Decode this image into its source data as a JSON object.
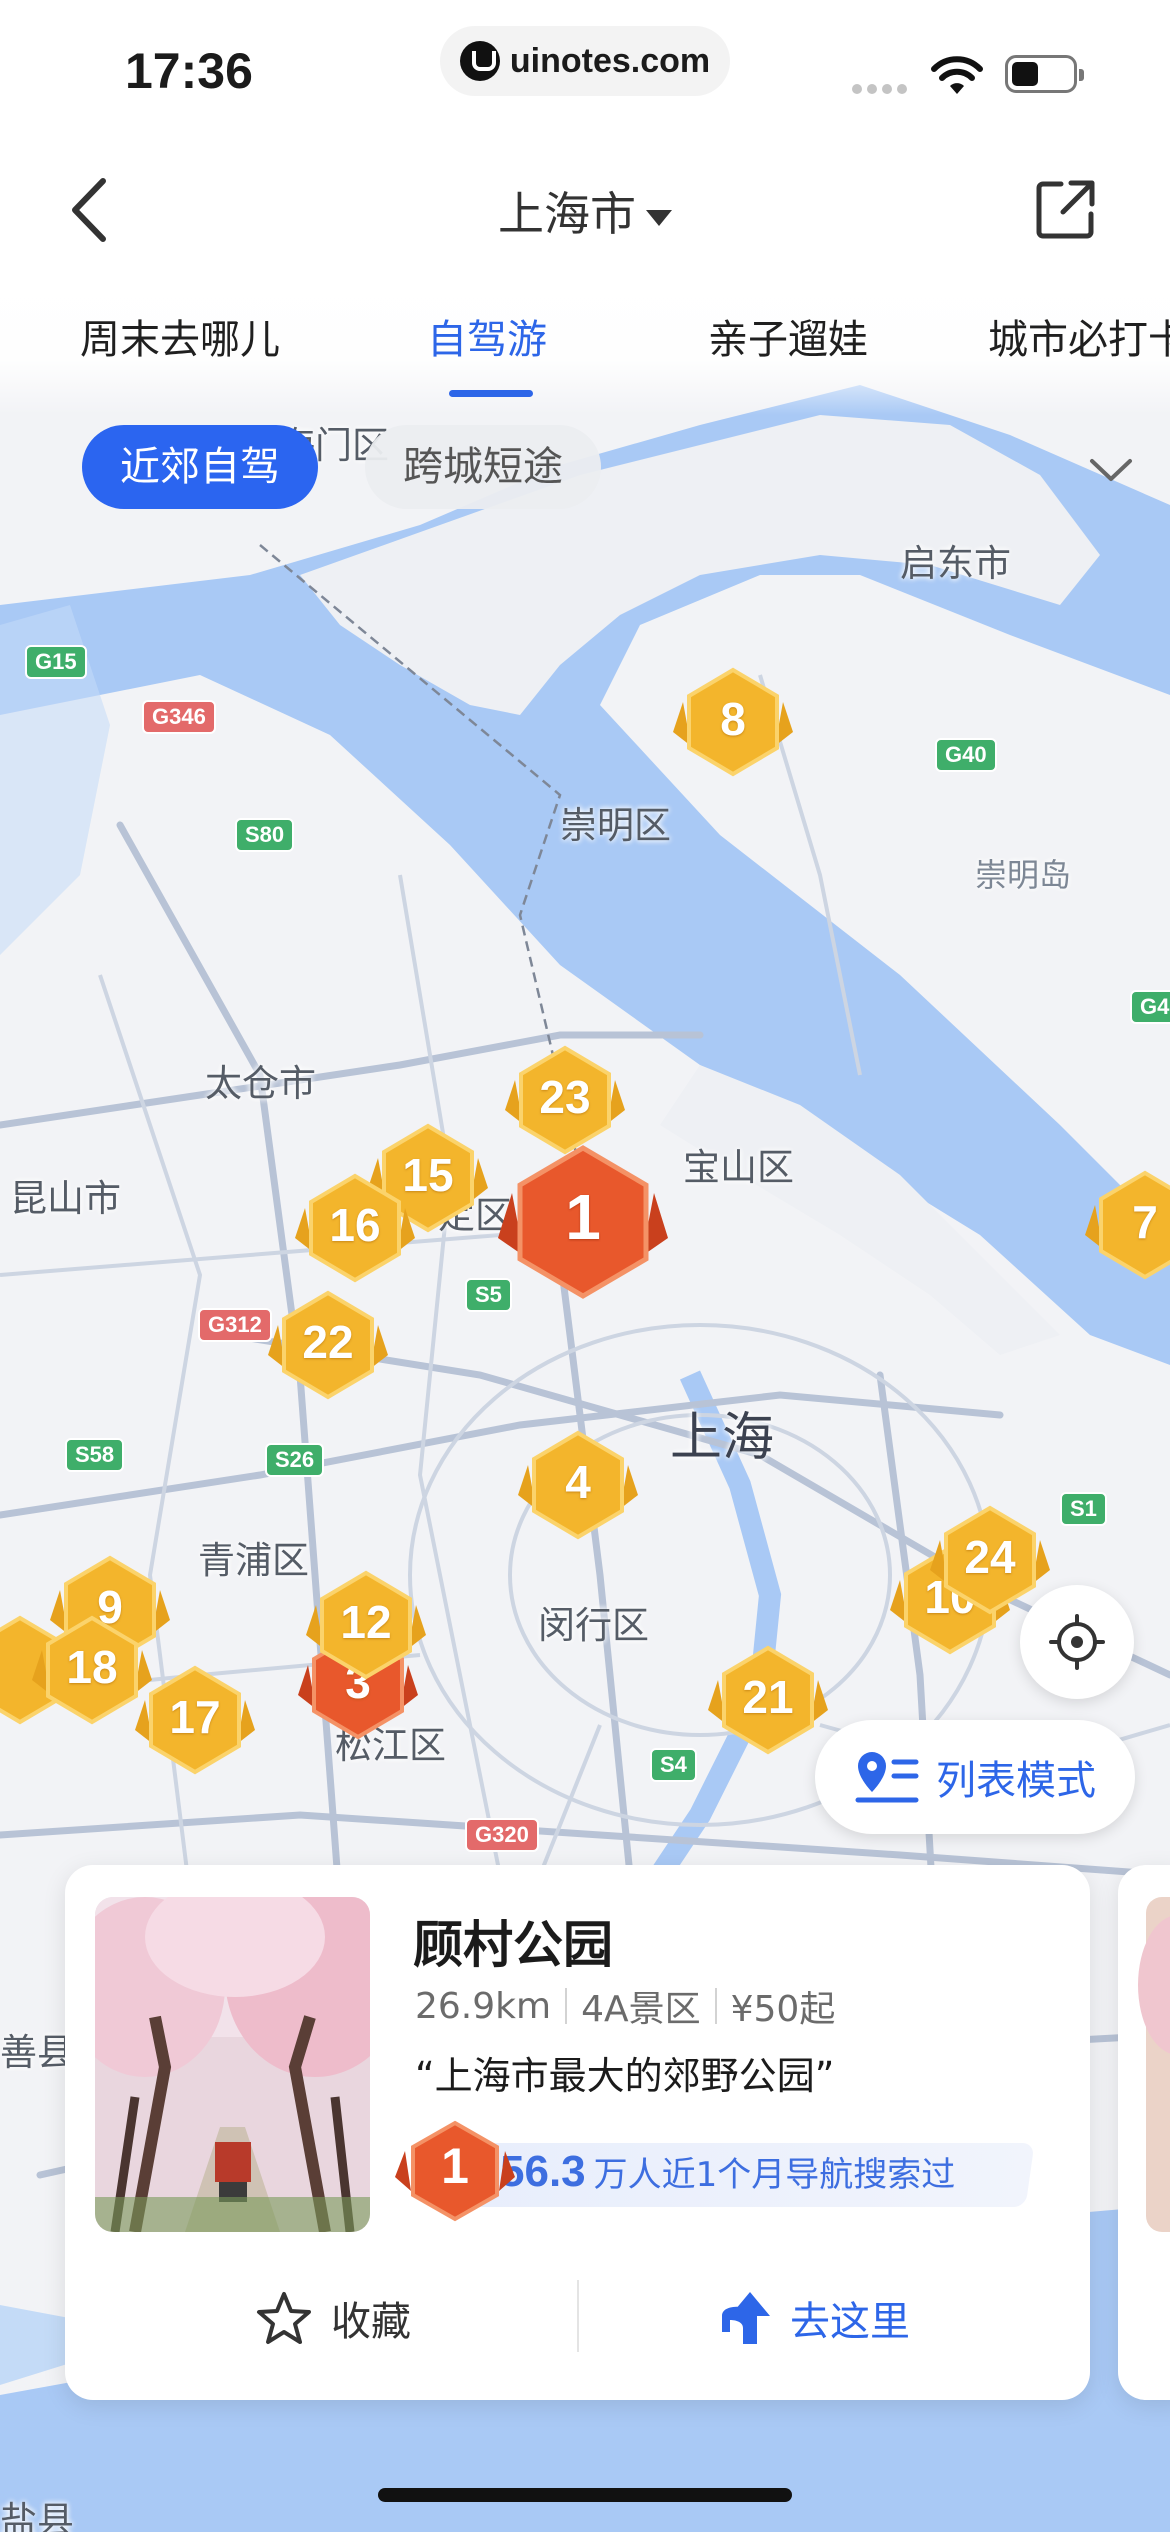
{
  "status_bar": {
    "time": "17:36",
    "url": "uinotes.com"
  },
  "nav": {
    "city": "上海市"
  },
  "tabs": [
    "周末去哪儿",
    "自驾游",
    "亲子遛娃",
    "城市必打卡"
  ],
  "active_tab": "自驾游",
  "chips": {
    "active": "近郊自驾",
    "inactive": "跨城短途"
  },
  "map": {
    "labels": {
      "haimen": "海门区",
      "qidong": "启东市",
      "chongming": "崇明区",
      "chongmingdao": "崇明岛",
      "taicang": "太仓市",
      "kunshan": "昆山市",
      "baoshan": "宝山区",
      "jiading": "定区",
      "shanghai": "上海",
      "qingpu": "青浦区",
      "minhang": "闵行区",
      "songjiang": "松江区",
      "shanxian": "善县",
      "yanxian": "盐县"
    },
    "roads": [
      "G15",
      "G346",
      "S80",
      "G40",
      "G4",
      "S5",
      "G312",
      "S26",
      "S58",
      "S1",
      "S4",
      "G320"
    ],
    "markers": [
      "8",
      "23",
      "15",
      "16",
      "1",
      "7",
      "22",
      "4",
      "24",
      "10",
      "9",
      "18",
      "12",
      "3",
      "17",
      "21"
    ]
  },
  "buttons": {
    "list_mode": "列表模式"
  },
  "card": {
    "name": "顾村公园",
    "distance": "26.9km",
    "level": "4A景区",
    "price": "¥50起",
    "quote": "“上海市最大的郊野公园”",
    "rank": "1",
    "searches": "56.3",
    "search_text": "万人近1个月导航搜索过",
    "favorite": "收藏",
    "go": "去这里"
  },
  "colors": {
    "accent": "#2d66e8",
    "marker_gold": "#f3b52c",
    "marker_top": "#e8582c"
  },
  "icons": [
    "back-icon",
    "share-icon",
    "chevron-down-icon",
    "locate-icon",
    "list-mode-icon",
    "star-icon",
    "navigate-arrow-icon"
  ]
}
